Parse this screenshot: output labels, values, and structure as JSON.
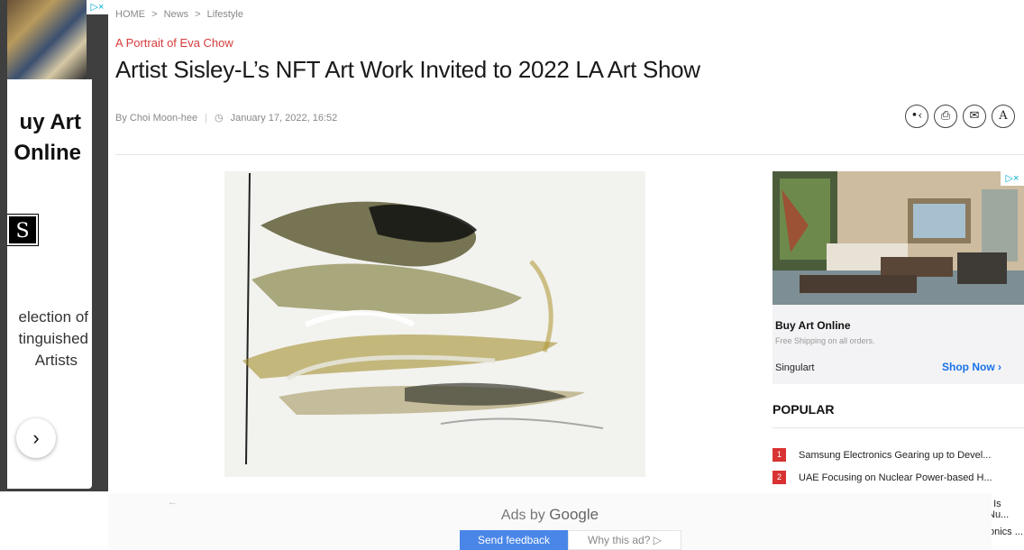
{
  "breadcrumb": [
    "HOME",
    ">",
    "News",
    ">",
    "Lifestyle"
  ],
  "article": {
    "subtitle": "A Portrait of Eva Chow",
    "headline": "Artist Sisley-L’s NFT Art Work Invited to 2022 LA Art Show",
    "author": "By Choi Moon-hee",
    "date": "January 17, 2022, 16:52",
    "clock_icon": "◷"
  },
  "tools": [
    {
      "name": "share-icon",
      "glyph": "•‹"
    },
    {
      "name": "print-icon",
      "glyph": "⎙"
    },
    {
      "name": "email-icon",
      "glyph": "✉"
    },
    {
      "name": "font-size-icon",
      "glyph": "A"
    }
  ],
  "left_ad": {
    "badge": "▷×",
    "title_line1": "uy Art",
    "title_line2": "Online",
    "logo": "S",
    "desc_line1": "election of",
    "desc_line2": "tinguished",
    "desc_line3": "Artists",
    "next_icon": "›"
  },
  "right_ad": {
    "badge": "▷×",
    "title": "Buy Art Online",
    "subtitle": "Free Shipping on all orders.",
    "brand": "Singulart",
    "cta": "Shop Now ›"
  },
  "popular": {
    "heading": "POPULAR",
    "items": [
      {
        "rank": "1",
        "title": "Samsung Electronics Gearing up to Devel..."
      },
      {
        "rank": "2",
        "title": "UAE Focusing on Nuclear Power-based H..."
      }
    ],
    "peek_3": ": Is Nu...",
    "peek_4": "onics ..."
  },
  "google_overlay": {
    "back_icon": "←",
    "ads_by": "Ads by",
    "google": "Google",
    "feedback": "Send feedback",
    "why": "Why this ad? ▷"
  },
  "colors": {
    "accent_red": "#d63b3b",
    "rank_red": "#d93232",
    "link_blue": "#1a73e8",
    "feedback_blue": "#4a86e8"
  }
}
